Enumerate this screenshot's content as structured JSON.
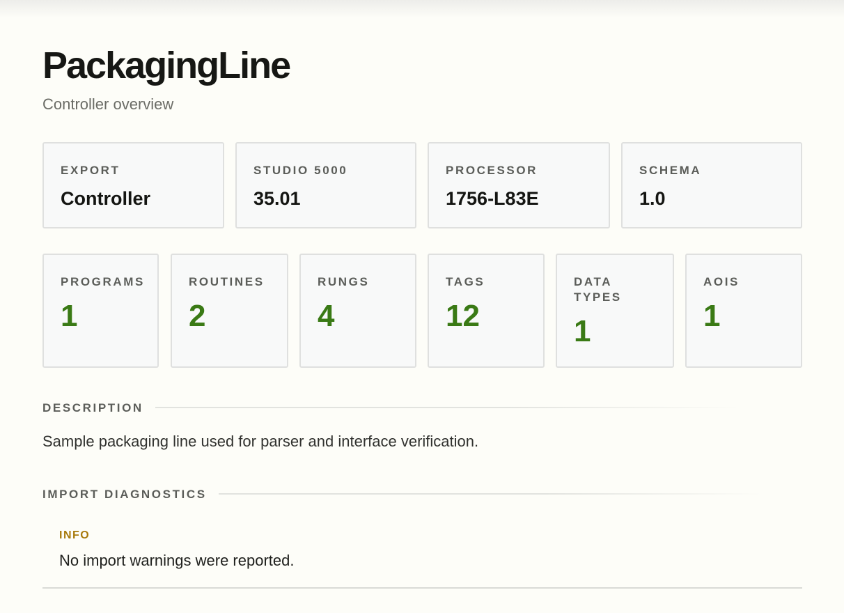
{
  "header": {
    "title": "PackagingLine",
    "subtitle": "Controller overview"
  },
  "info_cards": [
    {
      "label": "EXPORT",
      "value": "Controller"
    },
    {
      "label": "STUDIO 5000",
      "value": "35.01"
    },
    {
      "label": "PROCESSOR",
      "value": "1756-L83E"
    },
    {
      "label": "SCHEMA",
      "value": "1.0"
    }
  ],
  "stats": [
    {
      "label": "PROGRAMS",
      "value": "1"
    },
    {
      "label": "ROUTINES",
      "value": "2"
    },
    {
      "label": "RUNGS",
      "value": "4"
    },
    {
      "label": "TAGS",
      "value": "12"
    },
    {
      "label": "DATA TYPES",
      "value": "1"
    },
    {
      "label": "AOIS",
      "value": "1"
    }
  ],
  "description": {
    "heading": "DESCRIPTION",
    "text": "Sample packaging line used for parser and interface verification."
  },
  "diagnostics": {
    "heading": "IMPORT DIAGNOSTICS",
    "items": [
      {
        "level": "INFO",
        "message": "No import warnings were reported."
      }
    ]
  },
  "colors": {
    "background": "#fdfdf8",
    "stat_value": "#3a7a15",
    "info_level": "#a87a0c",
    "card_background": "#f8f9f9",
    "card_border": "#dfe0df"
  }
}
